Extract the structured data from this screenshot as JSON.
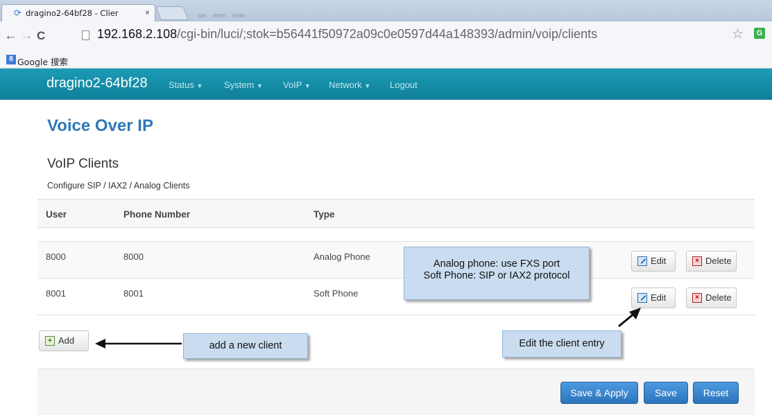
{
  "browser": {
    "tab_title": "dragino2-64bf28 - Clier",
    "tab_close": "×",
    "url_host": "192.168.2.108",
    "url_path": "/cgi-bin/luci/;stok=b56441f50972a09c0e0597d44a148393/admin/voip/clients",
    "extension_label": "G",
    "bookmark_icon": "8",
    "bookmark_label": "Google 搜索"
  },
  "navbar": {
    "brand": "dragino2-64bf28",
    "menu": [
      {
        "label": "Status"
      },
      {
        "label": "System"
      },
      {
        "label": "VoIP"
      },
      {
        "label": "Network"
      },
      {
        "label": "Logout"
      }
    ]
  },
  "page": {
    "title": "Voice Over IP",
    "section_title": "VoIP Clients",
    "section_desc": "Configure SIP / IAX2 / Analog Clients"
  },
  "table": {
    "columns": [
      "User",
      "Phone Number",
      "Type"
    ],
    "rows": [
      {
        "user": "8000",
        "phone": "8000",
        "type": "Analog Phone"
      },
      {
        "user": "8001",
        "phone": "8001",
        "type": "Soft Phone"
      }
    ],
    "edit_label": "Edit",
    "delete_label": "Delete"
  },
  "add_label": "Add",
  "callouts": {
    "type_line1": "Analog phone: use FXS port",
    "type_line2": "Soft Phone: SIP or IAX2 protocol",
    "add": "add a new client",
    "edit": "Edit the client entry"
  },
  "footer": {
    "save_apply": "Save & Apply",
    "save": "Save",
    "reset": "Reset"
  },
  "icons": {
    "back": "arrow-left-icon",
    "forward": "arrow-right-icon",
    "reload": "reload-icon",
    "star": "star-icon",
    "edit": "edit-icon",
    "delete": "delete-icon",
    "add": "add-icon"
  },
  "colors": {
    "navbar": "#1690ab",
    "title": "#2f78b8",
    "primary_button": "#337ab7",
    "callout": "#c9dcf0"
  }
}
